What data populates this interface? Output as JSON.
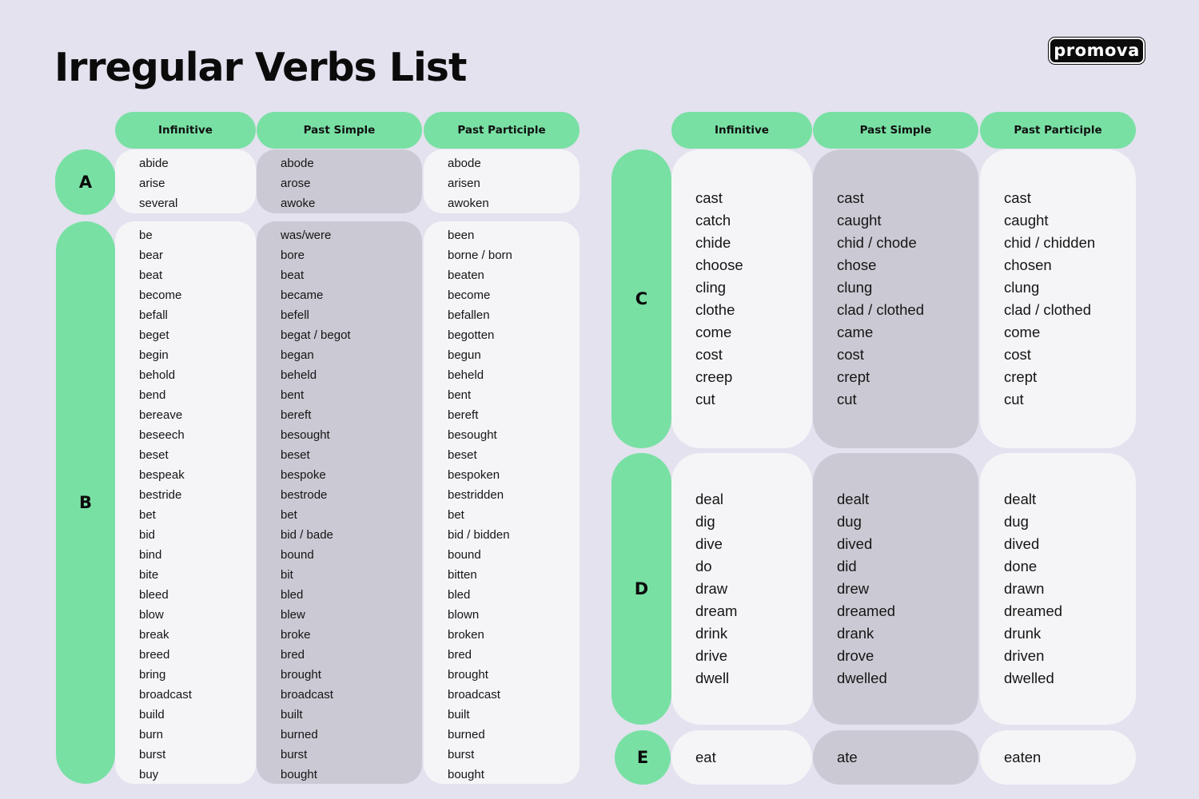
{
  "title": "Irregular Verbs List",
  "brand": "promova",
  "colors": {
    "background": "#e3e2ee",
    "accent_green": "#79e0a4",
    "cell_light": "#f5f5f8",
    "cell_dark": "#cbcad4"
  },
  "headers": [
    "Infinitive",
    "Past Simple",
    "Past Participle"
  ],
  "groups": {
    "A": {
      "letter": "A",
      "infinitive": [
        "abide",
        "arise",
        "several"
      ],
      "past_simple": [
        "abode",
        "arose",
        "awoke"
      ],
      "past_participle": [
        "abode",
        "arisen",
        "awoken"
      ]
    },
    "B": {
      "letter": "B",
      "infinitive": [
        "be",
        "bear",
        "beat",
        "become",
        "befall",
        "beget",
        "begin",
        "behold",
        "bend",
        "bereave",
        "beseech",
        "beset",
        "bespeak",
        "bestride",
        "bet",
        "bid",
        "bind",
        "bite",
        "bleed",
        "blow",
        "break",
        "breed",
        "bring",
        "broadcast",
        "build",
        "burn",
        "burst",
        "buy"
      ],
      "past_simple": [
        "was/were",
        "bore",
        "beat",
        "became",
        "befell",
        "begat / begot",
        "began",
        "beheld",
        "bent",
        "bereft",
        "besought",
        "beset",
        "bespoke",
        "bestrode",
        "bet",
        "bid / bade",
        "bound",
        "bit",
        "bled",
        "blew",
        "broke",
        "bred",
        "brought",
        "broadcast",
        "built",
        "burned",
        "burst",
        "bought"
      ],
      "past_participle": [
        "been",
        "borne / born",
        "beaten",
        "become",
        "befallen",
        "begotten",
        "begun",
        "beheld",
        "bent",
        "bereft",
        "besought",
        "beset",
        "bespoken",
        "bestridden",
        "bet",
        "bid / bidden",
        "bound",
        "bitten",
        "bled",
        "blown",
        "broken",
        "bred",
        "brought",
        "broadcast",
        "built",
        "burned",
        "burst",
        "bought"
      ]
    },
    "C": {
      "letter": "C",
      "infinitive": [
        "cast",
        "catch",
        "chide",
        "choose",
        "cling",
        "clothe",
        "come",
        "cost",
        "creep",
        "cut"
      ],
      "past_simple": [
        "cast",
        "caught",
        "chid / chode",
        "chose",
        "clung",
        "clad / clothed",
        "came",
        "cost",
        "crept",
        "cut"
      ],
      "past_participle": [
        "cast",
        "caught",
        "chid / chidden",
        "chosen",
        "clung",
        "clad / clothed",
        "come",
        "cost",
        "crept",
        "cut"
      ]
    },
    "D": {
      "letter": "D",
      "infinitive": [
        "deal",
        "dig",
        "dive",
        "do",
        "draw",
        "dream",
        "drink",
        "drive",
        "dwell"
      ],
      "past_simple": [
        "dealt",
        "dug",
        "dived",
        "did",
        "drew",
        "dreamed",
        "drank",
        "drove",
        "dwelled"
      ],
      "past_participle": [
        "dealt",
        "dug",
        "dived",
        "done",
        "drawn",
        "dreamed",
        "drunk",
        "driven",
        "dwelled"
      ]
    },
    "E": {
      "letter": "E",
      "infinitive": [
        "eat"
      ],
      "past_simple": [
        "ate"
      ],
      "past_participle": [
        "eaten"
      ]
    }
  }
}
